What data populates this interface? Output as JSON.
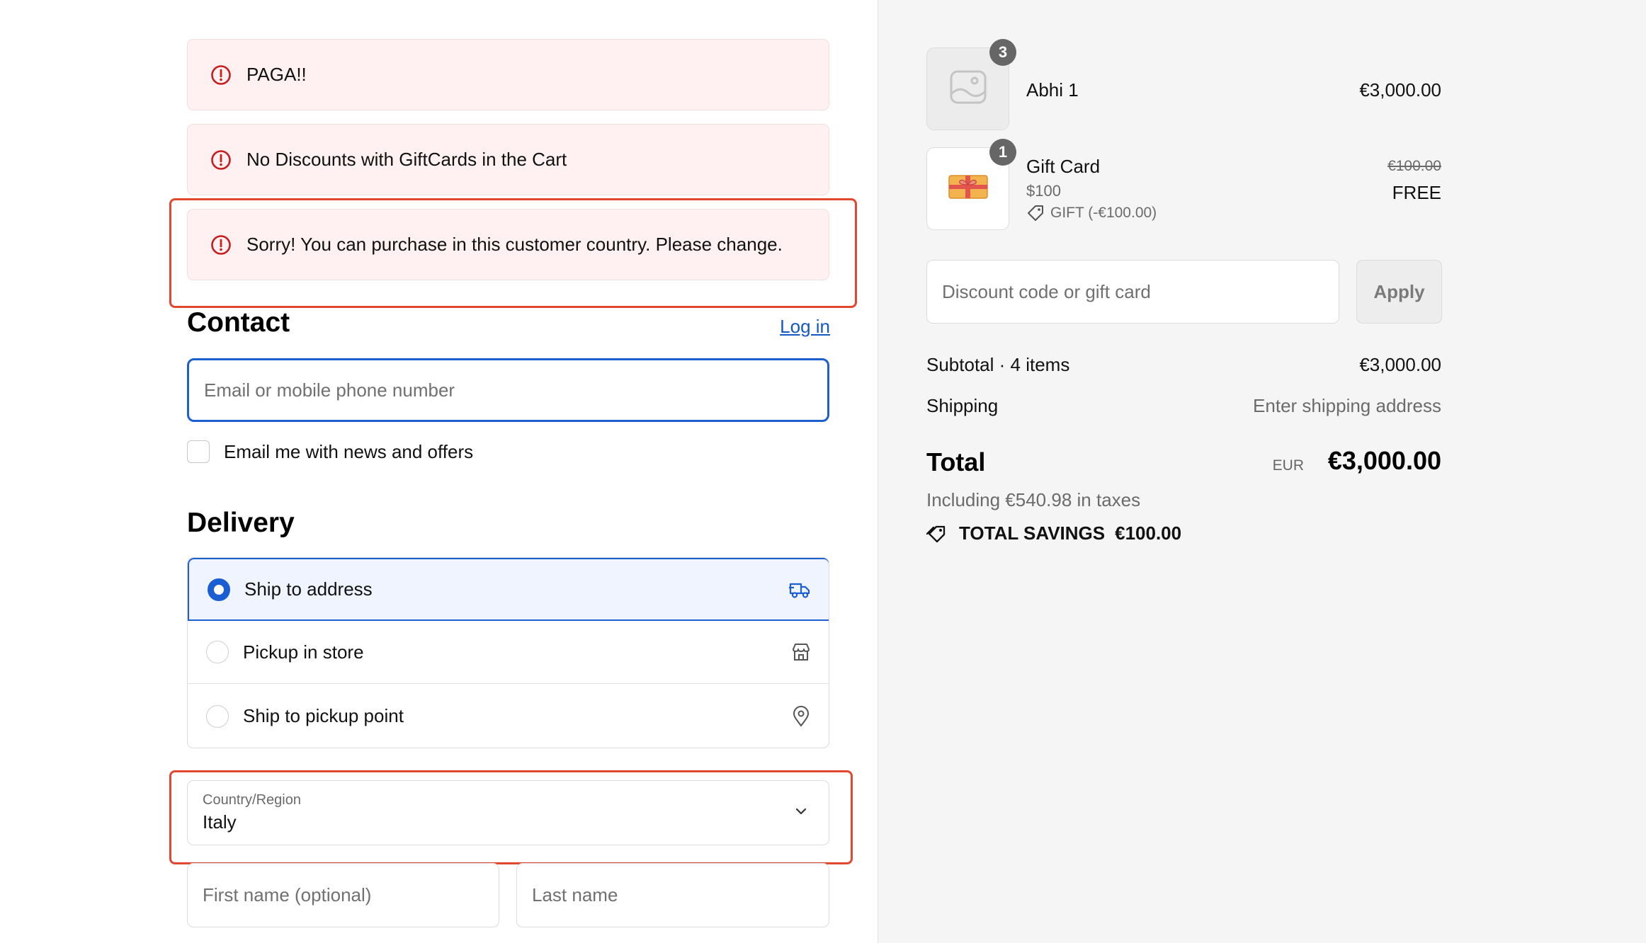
{
  "alerts": [
    {
      "text": "PAGA!!"
    },
    {
      "text": "No Discounts with GiftCards in the Cart"
    },
    {
      "text": "Sorry! You can purchase in this customer country. Please change."
    }
  ],
  "contact": {
    "title": "Contact",
    "login_link": "Log in",
    "email_placeholder": "Email or mobile phone number",
    "newsletter_label": "Email me with news and offers"
  },
  "delivery": {
    "title": "Delivery",
    "options": [
      {
        "label": "Ship to address",
        "selected": true,
        "icon": "truck-icon"
      },
      {
        "label": "Pickup in store",
        "selected": false,
        "icon": "store-icon"
      },
      {
        "label": "Ship to pickup point",
        "selected": false,
        "icon": "map-pin-icon"
      }
    ],
    "country_label": "Country/Region",
    "country_value": "Italy",
    "first_name_placeholder": "First name (optional)",
    "last_name_placeholder": "Last name"
  },
  "cart": {
    "items": [
      {
        "name": "Abhi 1",
        "quantity": "3",
        "price": "€3,000.00",
        "image_icon": "image-placeholder-icon"
      },
      {
        "name": "Gift Card",
        "quantity": "1",
        "variant": "$100",
        "discount_label": "GIFT (-€100.00)",
        "original_price": "€100.00",
        "price": "FREE",
        "image_icon": "gift-card-icon"
      }
    ],
    "discount_placeholder": "Discount code or gift card",
    "apply_label": "Apply",
    "subtotal_label": "Subtotal · 4 items",
    "subtotal_value": "€3,000.00",
    "shipping_label": "Shipping",
    "shipping_value": "Enter shipping address",
    "total_label": "Total",
    "total_currency": "EUR",
    "total_value": "€3,000.00",
    "taxes_note": "Including €540.98 in taxes",
    "savings_label": "TOTAL SAVINGS",
    "savings_value": "€100.00"
  },
  "colors": {
    "accent": "#1c5fd0",
    "error": "#c81e1e",
    "highlight_box": "#e2482f",
    "alert_bg": "#fff1f1"
  }
}
